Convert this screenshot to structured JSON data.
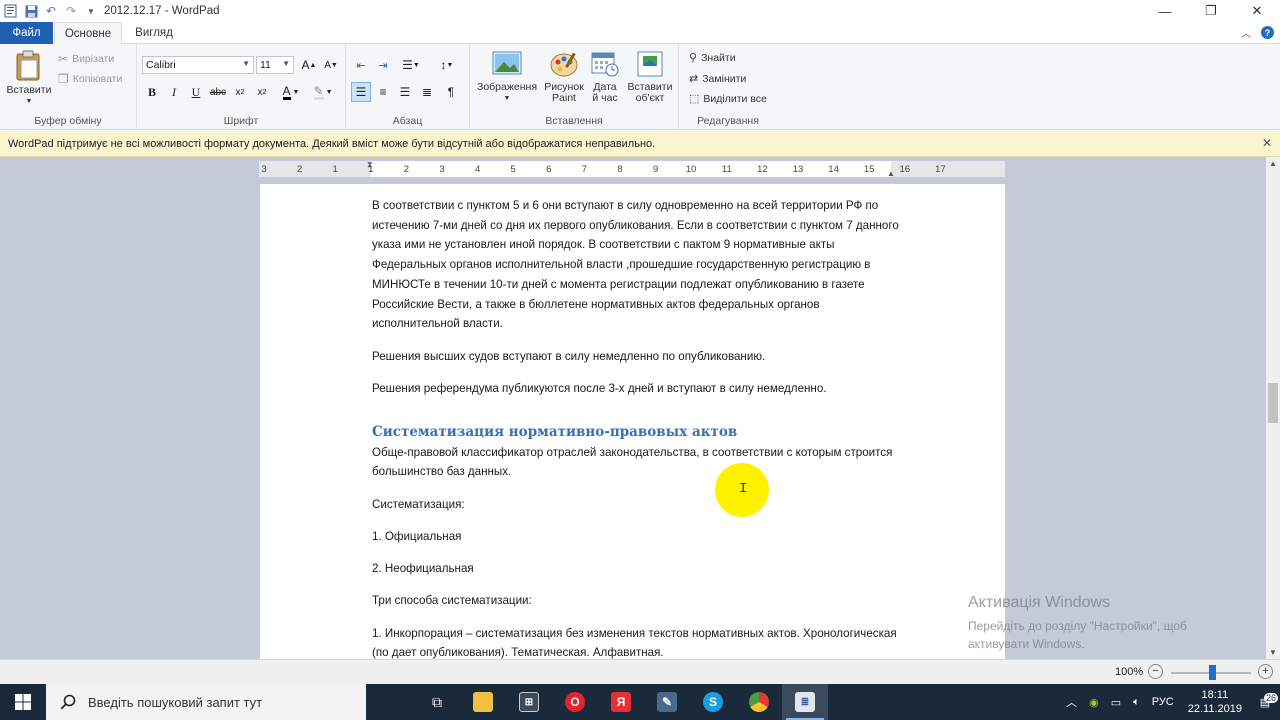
{
  "window": {
    "title": "2012.12.17 - WordPad",
    "controls": {
      "minimize": "—",
      "maximize": "❐",
      "close": "✕"
    }
  },
  "tabs": {
    "file": "Файл",
    "home": "Основне",
    "view": "Вигляд"
  },
  "ribbon": {
    "clipboard": {
      "label": "Буфер обміну",
      "paste": "Вставити",
      "cut": "Вирізати",
      "copy": "Копіювати"
    },
    "font": {
      "label": "Шрифт",
      "family": "Calibri",
      "size": "11"
    },
    "paragraph": {
      "label": "Абзац"
    },
    "insert": {
      "label": "Вставлення",
      "picture_l1": "Зображення",
      "paint_l1": "Рисунок",
      "paint_l2": "Paint",
      "datetime_l1": "Дата",
      "datetime_l2": "й час",
      "object_l1": "Вставити",
      "object_l2": "об'єкт"
    },
    "editing": {
      "label": "Редагування",
      "find": "Знайти",
      "replace": "Замінити",
      "select_all": "Виділити все"
    }
  },
  "infobar": {
    "message": "WordPad підтримує не всі можливості формату документа. Деякий вміст може бути відсутній або відображатися неправильно."
  },
  "ruler": {
    "ticks": [
      "3",
      "2",
      "1",
      "1",
      "2",
      "3",
      "4",
      "5",
      "6",
      "7",
      "8",
      "9",
      "10",
      "11",
      "12",
      "13",
      "14",
      "15",
      "16",
      "17"
    ]
  },
  "document": {
    "p1": "В соответствии с пунктом 5 и 6 они вступают в силу одновременно на всей территории РФ по истечению 7-ми дней со дня их первого опубликования. Если в соответствии с пунктом 7 данного указа ими не установлен иной порядок. В соответствии с пактом 9 нормативные акты Федеральных органов исполнительной власти ,прошедшие государственную регистрацию в МИНЮСТе в течении 10-ти дней с момента регистрации подлежат опубликованию в газете Российские Вести, а также в бюллетене нормативных актов федеральных органов исполнительной власти.",
    "p2": "Решения высших судов вступают в силу немедленно по опубликованию.",
    "p3": "Решения референдума публикуются после 3-х дней и вступают в силу немедленно.",
    "heading": "Систематизация нормативно-правовых актов",
    "p4": "Обще-правовой классификатор отраслей законодательства, в соответствии с которым строится большинство баз данных.",
    "p5": "Систематизация:",
    "p6": "1. Официальная",
    "p7": "2. Неофициальная",
    "p8": "Три способа систематизации:",
    "p9": "1. Инкорпорация – систематизация без изменения текстов нормативных актов. Хронологическая (по дает опубликования). Тематическая. Алфавитная."
  },
  "activation": {
    "title": "Активація Windows",
    "line1": "Перейдіть до розділу \"Настройки\", щоб",
    "line2": "активувати Windows."
  },
  "status": {
    "zoom": "100%",
    "zoom_level_percent": 100
  },
  "taskbar": {
    "search_placeholder": "Введіть пошуковий запит тут",
    "lang": "РУС",
    "time": "18:11",
    "date": "22.11.2019",
    "notifications": "26"
  },
  "colors": {
    "accent": "#1f5fb4",
    "heading": "#3a6fb5",
    "infobar": "#fcf3cf",
    "highlight": "#fff200",
    "taskbar": "#1b2a3a"
  }
}
